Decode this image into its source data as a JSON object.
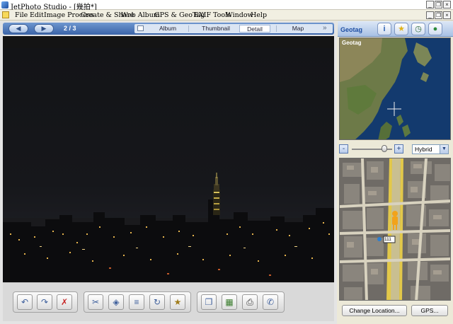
{
  "window": {
    "title": "JetPhoto Studio - [幾拍*]",
    "controls": {
      "minimize": "_",
      "restore": "❐",
      "close": "×"
    }
  },
  "menu": {
    "items": [
      "File",
      "Edit",
      "Image Process",
      "Create & Share",
      "Web Album",
      "GPS & GeoTag",
      "EXIF Tools",
      "Window",
      "Help"
    ]
  },
  "viewer": {
    "back_icon": "back-arrow-icon",
    "forward_icon": "forward-arrow-icon",
    "page_counter": "2 / 3",
    "tabs": [
      {
        "label": "Album",
        "active": false
      },
      {
        "label": "Thumbnail",
        "active": false
      },
      {
        "label": "Detail",
        "active": true
      },
      {
        "label": "Map",
        "active": false
      }
    ],
    "more_label": "»"
  },
  "toolbar": {
    "groups": [
      {
        "buttons": [
          "undo-icon",
          "redo-icon",
          "delete-icon"
        ]
      },
      {
        "buttons": [
          "cut-icon",
          "eraser-icon",
          "adjust-icon",
          "rotate-icon",
          "effects-icon"
        ]
      },
      {
        "buttons": [
          "slideshow-icon",
          "wallpaper-icon",
          "print-icon",
          "mobile-icon"
        ]
      }
    ]
  },
  "geotag_panel": {
    "label": "Geotag",
    "tabs": [
      "info-icon",
      "star-icon",
      "clock-icon",
      "globe-icon"
    ],
    "map_type": "Hybrid",
    "zoom_level": 0.8,
    "overview_labels": [],
    "detail_road_number": "111",
    "buttons": {
      "change_location": "Change Location...",
      "gps": "GPS..."
    }
  },
  "colors": {
    "accent": "#3a64a8",
    "panel_header": "#a8c1e5",
    "photo_bg": "#141414"
  }
}
